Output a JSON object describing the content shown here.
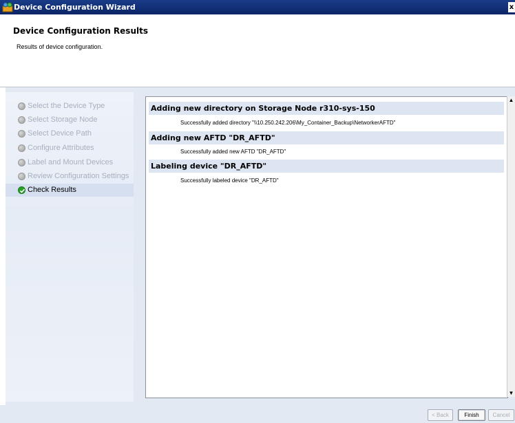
{
  "window": {
    "title": "Device Configuration Wizard",
    "close_label": "x"
  },
  "header": {
    "title": "Device Configuration Results",
    "subtitle": "Results of device configuration."
  },
  "steps": [
    {
      "label": "Select the Device Type",
      "state": "pending"
    },
    {
      "label": "Select Storage Node",
      "state": "pending"
    },
    {
      "label": "Select Device Path",
      "state": "pending"
    },
    {
      "label": "Configure Attributes",
      "state": "pending"
    },
    {
      "label": "Label and Mount Devices",
      "state": "pending"
    },
    {
      "label": "Review Configuration Settings",
      "state": "pending"
    },
    {
      "label": "Check Results",
      "state": "active"
    }
  ],
  "results": [
    {
      "heading": "Adding new directory on Storage Node r310-sys-150",
      "message": "Successfully added directory \"\\\\10.250.242.206\\My_Container_Backup\\NetworkerAFTD\""
    },
    {
      "heading": "Adding new AFTD \"DR_AFTD\"",
      "message": "Successfully added new AFTD \"DR_AFTD\""
    },
    {
      "heading": "Labeling device \"DR_AFTD\"",
      "message": "Successfully labeled device \"DR_AFTD\""
    }
  ],
  "footer": {
    "back_label": "< Back",
    "finish_label": "Finish",
    "cancel_label": "Cancel"
  },
  "icons": {
    "app": "device-wizard-icon",
    "step_pending": "gray-circle-icon",
    "step_active": "green-check-icon",
    "scroll_up": "scroll-up-arrow-icon",
    "scroll_down": "scroll-down-arrow-icon"
  }
}
